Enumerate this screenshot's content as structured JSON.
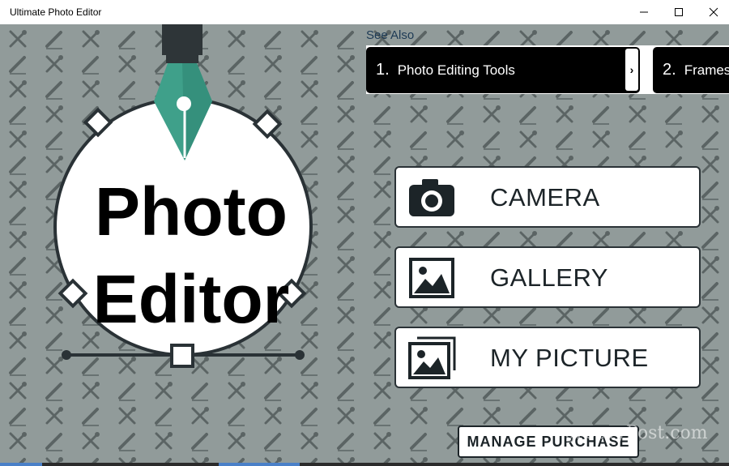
{
  "window": {
    "title": "Ultimate Photo Editor",
    "controls": [
      "minimize",
      "maximize",
      "close"
    ]
  },
  "logo": {
    "line1": "Photo",
    "line2": "Editor"
  },
  "see_also": {
    "heading": "See Also",
    "cards": [
      {
        "number": "1.",
        "label": "Photo Editing Tools",
        "arrow": "›"
      },
      {
        "number": "2.",
        "label": "Frames"
      }
    ]
  },
  "actions": {
    "camera": "CAMERA",
    "gallery": "GALLERY",
    "my_picture": "MY PICTURE",
    "manage_purchase": "MANAGE PURCHASE"
  },
  "watermark": "groovyPost.com",
  "colors": {
    "background": "#919b9a",
    "pen_teal": "#3fa08a",
    "dark": "#1c2428"
  }
}
